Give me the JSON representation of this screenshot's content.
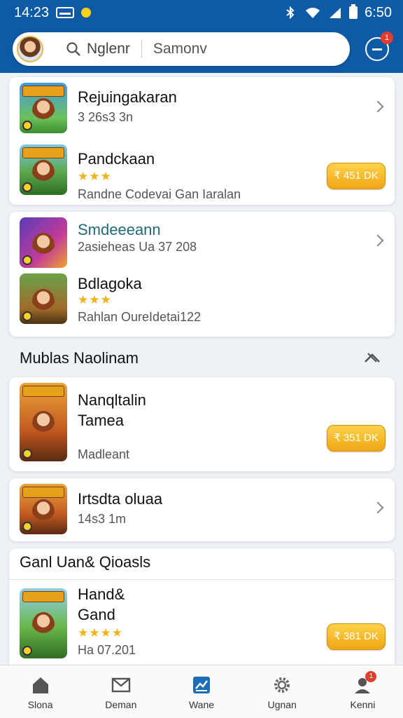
{
  "status_bar": {
    "time": "14:23",
    "right_time": "6:50"
  },
  "search": {
    "query": "Nglenr",
    "scope": "Samonv"
  },
  "notifications": {
    "badge": "1"
  },
  "card1": [
    {
      "title": "Rejuingakaran",
      "subtitle": "3 26s3 3n",
      "stars": "",
      "action": "chevron",
      "thumb": "blue"
    },
    {
      "title": "Pandckaan",
      "subtitle": "Randne Codevai Gan Iaralan",
      "stars": "★★★",
      "action": "price",
      "price": "₹ 451 DK",
      "thumb": "green"
    }
  ],
  "card2": [
    {
      "title": "Smdeeeann",
      "subtitle": "2asieheas Ua 37 208",
      "stars": "",
      "action": "chevron",
      "thumb": "purple"
    },
    {
      "title": "Bdlagoka",
      "subtitle": "Rahlan OureIdetai122",
      "stars": "★★★",
      "action": "none",
      "thumb": "forest"
    }
  ],
  "section1": {
    "title": "Mublas Naolinam"
  },
  "card3": {
    "title_line1": "Nanqltalin",
    "title_line2": "Tamea",
    "subtitle": "Madleant",
    "price": "₹ 351 DK",
    "thumb": "orange"
  },
  "card4": {
    "title": "Irtsdta oluaa",
    "subtitle": "14s3 1m",
    "thumb": "orange"
  },
  "section2": {
    "title": "Ganl Uan& Qioasls"
  },
  "card5": {
    "title_line1": "Hand&",
    "title_line2": "Gand",
    "stars": "★★★★",
    "subtitle": "Ha 07.201",
    "price": "₹ 381 DK",
    "thumb": "lime"
  },
  "bottom_nav": [
    {
      "label": "Slona",
      "icon": "home-icon"
    },
    {
      "label": "Deman",
      "icon": "mail-icon"
    },
    {
      "label": "Wane",
      "icon": "chart-icon"
    },
    {
      "label": "Ugnan",
      "icon": "gear-icon"
    },
    {
      "label": "Kenni",
      "icon": "profile-icon",
      "badge": "1"
    }
  ],
  "colors": {
    "primary": "#0f5aa5",
    "price_button": "#f5b21f",
    "star": "#f2b21b"
  }
}
